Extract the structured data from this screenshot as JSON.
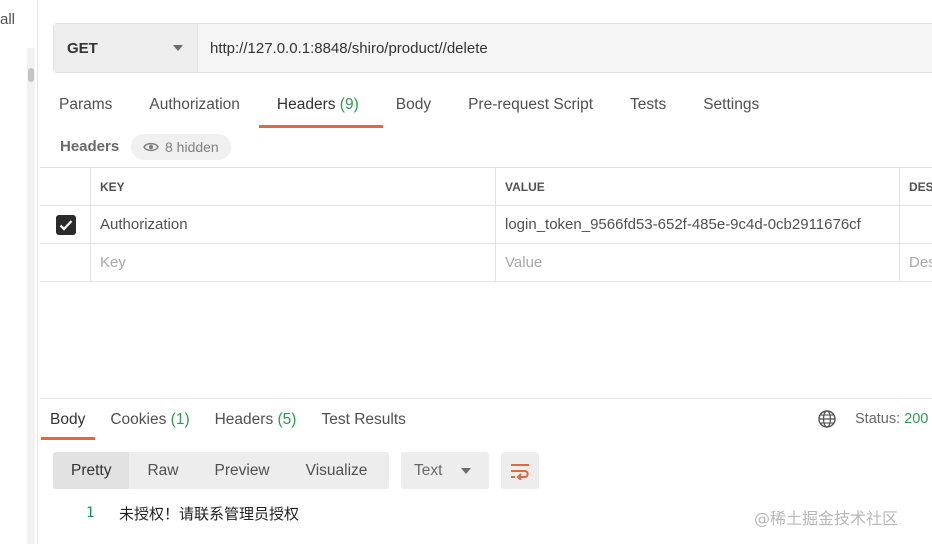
{
  "sidebar": {
    "partial_text": "all"
  },
  "request": {
    "method": "GET",
    "url": "http://127.0.0.1:8848/shiro/product//delete"
  },
  "request_tabs": [
    {
      "label": "Params",
      "count": ""
    },
    {
      "label": "Authorization",
      "count": ""
    },
    {
      "label": "Headers",
      "count": "(9)"
    },
    {
      "label": "Body",
      "count": ""
    },
    {
      "label": "Pre-request Script",
      "count": ""
    },
    {
      "label": "Tests",
      "count": ""
    },
    {
      "label": "Settings",
      "count": ""
    }
  ],
  "headers_section": {
    "title": "Headers",
    "hidden_label": "8 hidden"
  },
  "table": {
    "columns": {
      "key": "KEY",
      "value": "VALUE",
      "description": "DESCRIPTION"
    },
    "rows": [
      {
        "checked": true,
        "key": "Authorization",
        "value": "login_token_9566fd53-652f-485e-9c4d-0cb2911676cf"
      }
    ],
    "placeholders": {
      "key": "Key",
      "value": "Value",
      "description": "Description"
    }
  },
  "response_tabs": [
    {
      "label": "Body",
      "count": ""
    },
    {
      "label": "Cookies",
      "count": "(1)"
    },
    {
      "label": "Headers",
      "count": "(5)"
    },
    {
      "label": "Test Results",
      "count": ""
    }
  ],
  "status": {
    "label": "Status:",
    "code": "200"
  },
  "view_modes": [
    "Pretty",
    "Raw",
    "Preview",
    "Visualize"
  ],
  "format": "Text",
  "response_body": {
    "line_number": "1",
    "text": "未授权！请联系管理员授权"
  },
  "watermark": "@稀土掘金技术社区",
  "colors": {
    "accent_tab": "#e0683d",
    "count_green": "#2e9b4e",
    "line_number": "#1f8a6b"
  }
}
